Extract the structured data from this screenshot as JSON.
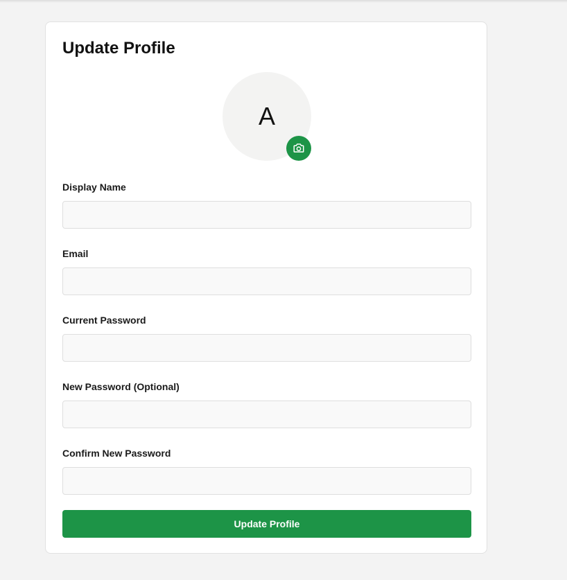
{
  "form": {
    "title": "Update Profile",
    "avatar_initial": "A",
    "avatar_button_icon": "camera-icon",
    "fields": [
      {
        "label": "Display Name",
        "value": "",
        "placeholder": ""
      },
      {
        "label": "Email",
        "value": "",
        "placeholder": ""
      },
      {
        "label": "Current Password",
        "value": "",
        "placeholder": ""
      },
      {
        "label": "New Password (Optional)",
        "value": "",
        "placeholder": ""
      },
      {
        "label": "Confirm New Password",
        "value": "",
        "placeholder": ""
      }
    ],
    "submit_label": "Update Profile"
  },
  "colors": {
    "accent": "#1d9447",
    "background": "#f3f3f3",
    "card": "#ffffff",
    "input_background": "#f9f9f9",
    "avatar_background": "#f3f3f2"
  }
}
